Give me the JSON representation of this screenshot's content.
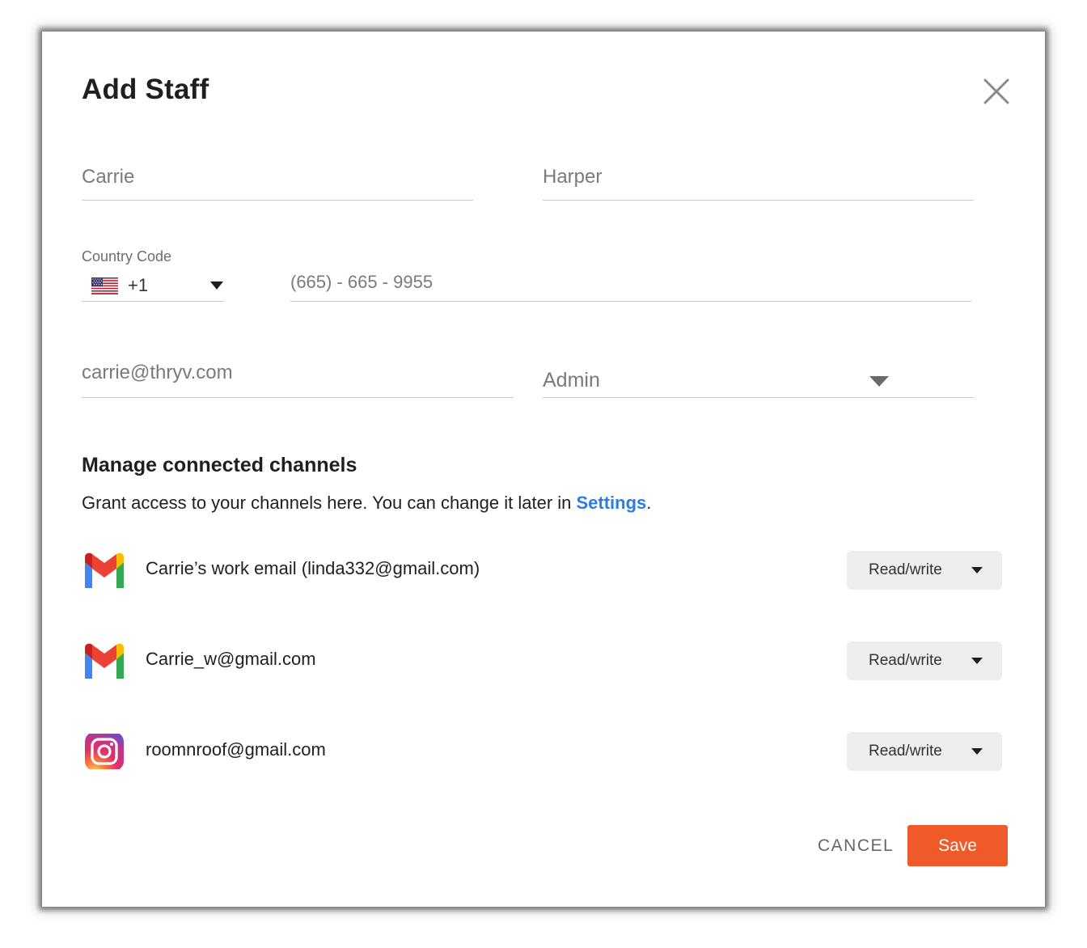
{
  "modal": {
    "title": "Add Staff"
  },
  "form": {
    "first_name_placeholder": "Carrie",
    "last_name_placeholder": "Harper",
    "country_code_label": "Country Code",
    "country_code_value": "+1",
    "phone_placeholder": "(665) - 665 - 9955",
    "email_placeholder": "carrie@thryv.com",
    "role_value": "Admin"
  },
  "channels_section": {
    "title": "Manage connected channels",
    "description_prefix": "Grant access to your channels here. You can change it later in ",
    "settings_link": "Settings",
    "description_suffix": ".",
    "link_color": "#2d7be5"
  },
  "channels": [
    {
      "icon": "gmail-icon",
      "label": "Carrie’s work email (linda332@gmail.com)",
      "permission": "Read/write"
    },
    {
      "icon": "gmail-icon",
      "label": "Carrie_w@gmail.com",
      "permission": "Read/write"
    },
    {
      "icon": "instagram-icon",
      "label": "roomnroof@gmail.com",
      "permission": "Read/write"
    }
  ],
  "actions": {
    "cancel_label": "CANCEL",
    "save_label": "Save",
    "save_color": "#f05a28"
  }
}
